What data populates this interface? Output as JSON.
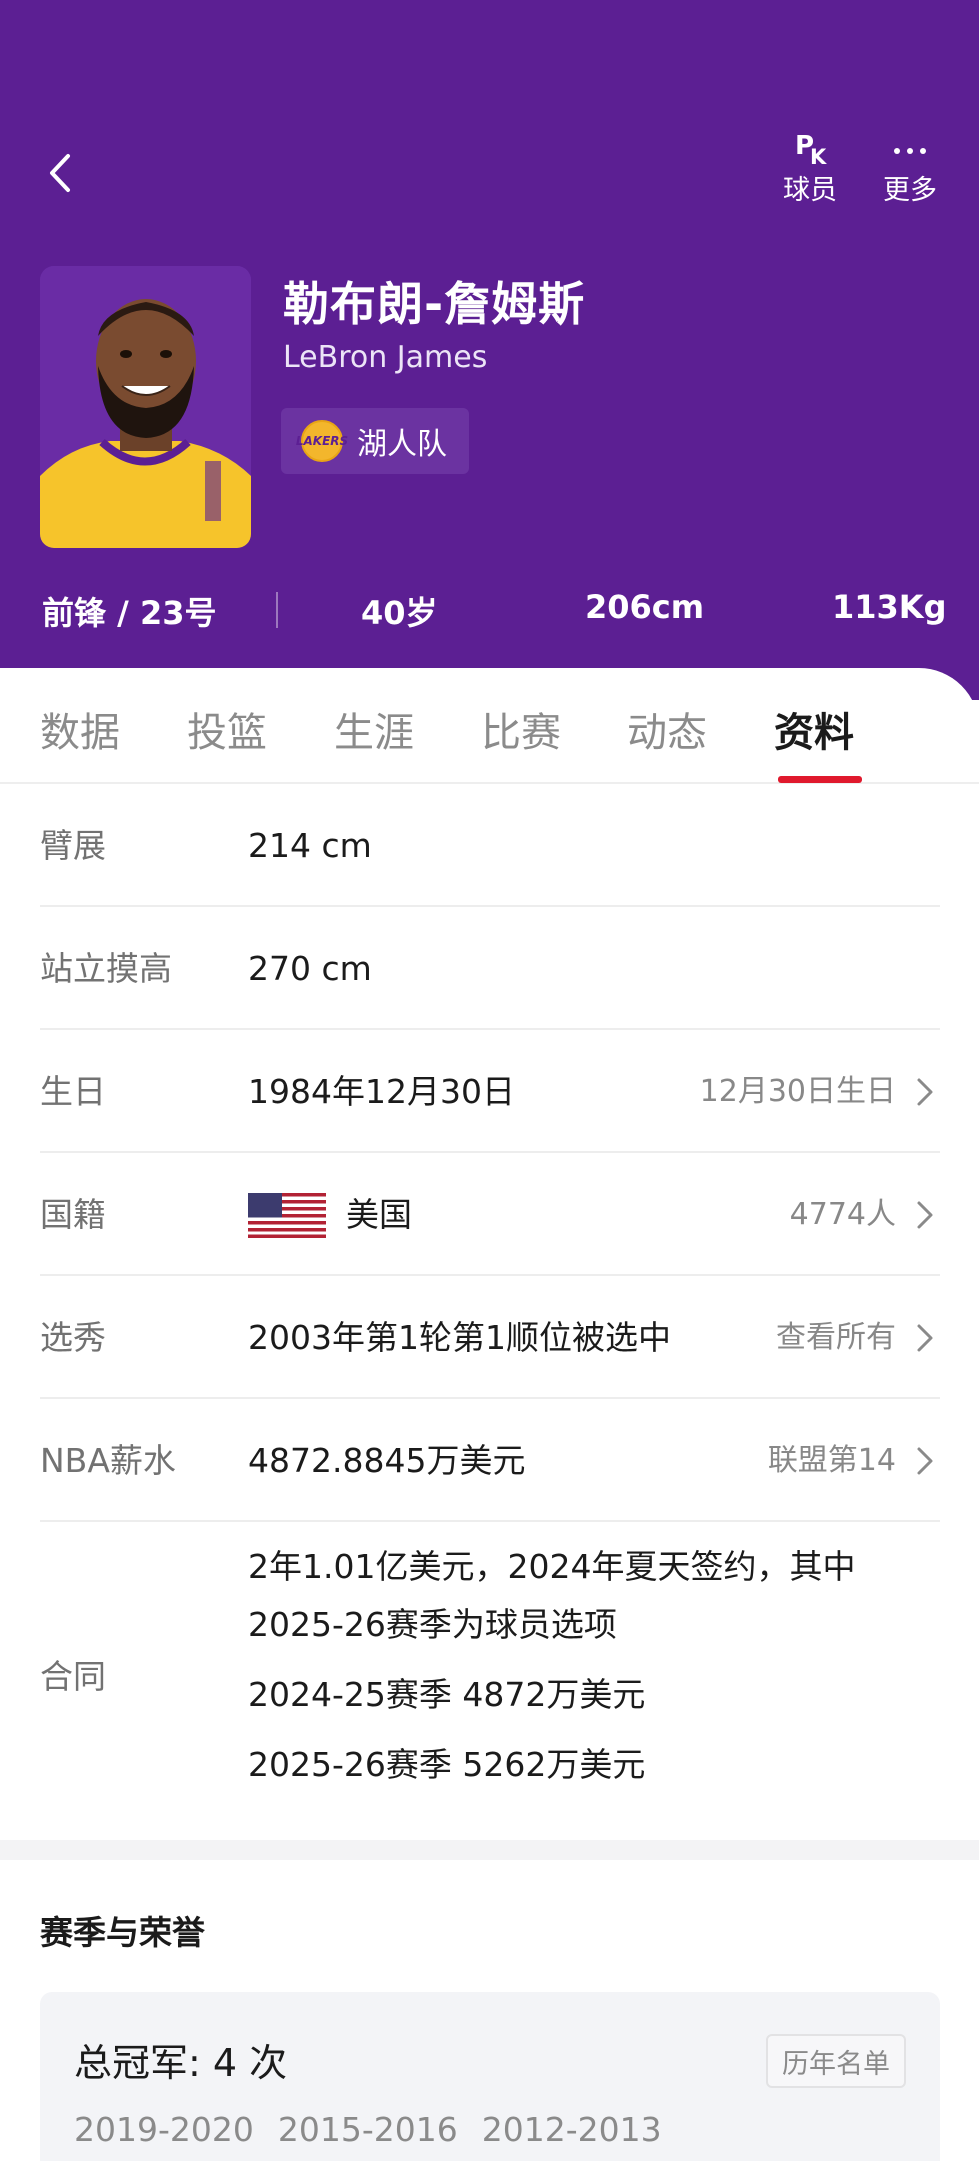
{
  "header": {
    "back_icon": "chevron-left-icon",
    "actions": [
      {
        "icon": "pk-icon",
        "label": "球员"
      },
      {
        "icon": "more-dots-icon",
        "label": "更多"
      }
    ],
    "name_cn": "勒布朗-詹姆斯",
    "name_en": "LeBron James",
    "team": {
      "name": "湖人队",
      "logo_text": "LAKERS"
    },
    "stats": {
      "position": "前锋 / 23号",
      "age": "40岁",
      "height": "206cm",
      "weight": "113Kg"
    },
    "colors": {
      "background": "#5c1f93",
      "accent": "#e0192d"
    }
  },
  "tabs": [
    "数据",
    "投篮",
    "生涯",
    "比赛",
    "动态",
    "资料"
  ],
  "active_tab": "资料",
  "info": [
    {
      "label": "臂展",
      "value": "214 cm",
      "right": "",
      "chevron": false
    },
    {
      "label": "站立摸高",
      "value": "270 cm",
      "right": "",
      "chevron": false
    },
    {
      "label": "生日",
      "value": "1984年12月30日",
      "right": "12月30日生日",
      "chevron": true
    },
    {
      "label": "国籍",
      "value": "美国",
      "right": "4774人",
      "chevron": true,
      "flag": "us-flag"
    },
    {
      "label": "选秀",
      "value": "2003年第1轮第1顺位被选中",
      "right": "查看所有",
      "chevron": true
    },
    {
      "label": "NBA薪水",
      "value": "4872.8845万美元",
      "right": "联盟第14",
      "chevron": true
    }
  ],
  "contract": {
    "label": "合同",
    "lines": [
      "2年1.01亿美元，2024年夏天签约，其中",
      "2025-26赛季为球员选项",
      "2024-25赛季 4872万美元",
      "2025-26赛季 5262万美元"
    ]
  },
  "honors": {
    "title": "赛季与荣誉",
    "card_title": "总冠军: 4 次",
    "button": "历年名单",
    "seasons": [
      "2019-2020",
      "2015-2016",
      "2012-2013"
    ]
  }
}
